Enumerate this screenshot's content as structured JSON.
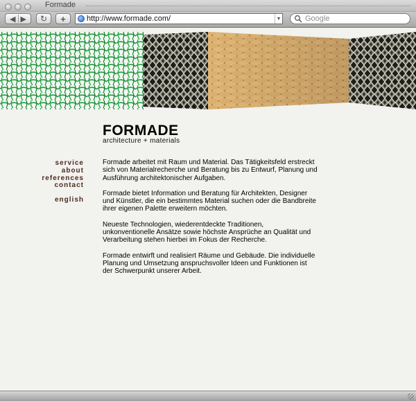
{
  "window": {
    "title": "Formade"
  },
  "toolbar": {
    "url": "http://www.formade.com/",
    "search_placeholder": "Google",
    "reload_glyph": "↻",
    "add_glyph": "+"
  },
  "brand": {
    "name": "FORMADE",
    "tagline": "architecture + materials"
  },
  "nav": {
    "items": [
      "service",
      "about",
      "references",
      "contact"
    ],
    "language": "english"
  },
  "colors": {
    "nav_text": "#4b2c20",
    "page_bg": "#f2f2ee",
    "green_mesh": "#1b9a3a",
    "wood": "#d6a866"
  },
  "banner": {
    "panels": [
      "green-mesh",
      "woven-metal",
      "wooden-lattice",
      "woven-metal"
    ]
  },
  "content": {
    "paragraphs": [
      "Formade arbeitet mit Raum und Material. Das Tätigkeitsfeld erstreckt sich von Materialrecherche und Beratung bis zu Entwurf, Planung und Ausführung architektonischer Aufgaben.",
      "Formade bietet Information und Beratung für Architekten, Designer und Künstler, die ein bestimmtes Material suchen oder die Bandbreite ihrer eigenen Palette erweitern möchten.",
      "Neueste Technologien, wiederentdeckte Traditionen, unkonventionelle Ansätze sowie höchste Ansprüche an Qualität und Verarbeitung stehen hierbei im Fokus der Recherche.",
      "Formade entwirft und realisiert Räume und Gebäude. Die individuelle Planung und Umsetzung anspruchsvoller Ideen und Funktionen ist der Schwerpunkt unserer Arbeit."
    ]
  }
}
